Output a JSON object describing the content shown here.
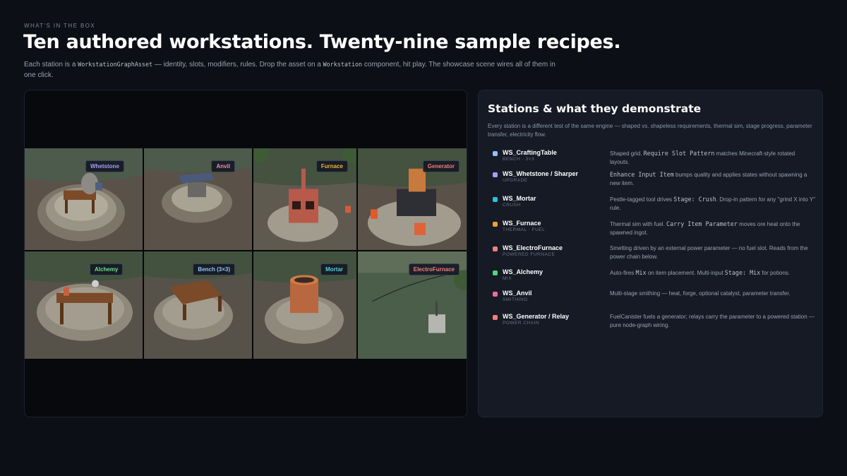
{
  "header": {
    "eyebrow": "WHAT'S IN THE BOX",
    "title": "Ten authored workstations. Twenty-nine sample recipes.",
    "lede": [
      {
        "t": "Each station is a "
      },
      {
        "t": "WorkstationGraphAsset",
        "code": true
      },
      {
        "t": " — identity, slots, modifiers, rules. Drop the asset on a "
      },
      {
        "t": "Workstation",
        "code": true
      },
      {
        "t": " component, hit play. The showcase scene wires all of them in one click."
      }
    ]
  },
  "showcase": {
    "tiles": [
      {
        "label": "Whetstone",
        "color": "#a99cff",
        "scene": "whetstone"
      },
      {
        "label": "Anvil",
        "color": "#f38ab5",
        "scene": "anvil"
      },
      {
        "label": "Furnace",
        "color": "#f0b440",
        "scene": "furnace"
      },
      {
        "label": "Generator",
        "color": "#f27d7d",
        "scene": "generator"
      },
      {
        "label": "Alchemy",
        "color": "#6ee08a",
        "scene": "alchemy"
      },
      {
        "label": "Bench (3×3)",
        "color": "#8fc2ff",
        "scene": "bench"
      },
      {
        "label": "Mortar",
        "color": "#4fd1e6",
        "scene": "mortar"
      },
      {
        "label": "ElectroFurnace",
        "color": "#f27d7d",
        "scene": "electro"
      }
    ]
  },
  "panel": {
    "title": "Stations & what they demonstrate",
    "subtitle": "Every station is a different test of the same engine — shaped vs. shapeless requirements, thermal sim, stage progress, parameter transfer, electricity flow.",
    "stations": [
      {
        "name": "WS_CraftingTable",
        "category": "BENCH · 3×3",
        "color": "#8fc2ff",
        "desc": [
          {
            "t": "Shaped grid. "
          },
          {
            "t": "Require Slot Pattern",
            "code": true
          },
          {
            "t": " matches Minecraft-style rotated layouts."
          }
        ]
      },
      {
        "name": "WS_Whetstone / Sharper",
        "category": "UPGRADE",
        "color": "#a99cff",
        "desc": [
          {
            "t": "Enhance Input Item",
            "code": true
          },
          {
            "t": " bumps quality and applies states without spawning a new item."
          }
        ]
      },
      {
        "name": "WS_Mortar",
        "category": "CRUSH",
        "color": "#2ec4dc",
        "desc": [
          {
            "t": "Pestle-tagged tool drives "
          },
          {
            "t": "Stage: Crush",
            "code": true
          },
          {
            "t": ". Drop-in pattern for any \"grind X into Y\" rule."
          }
        ]
      },
      {
        "name": "WS_Furnace",
        "category": "THERMAL · FUEL",
        "color": "#f0a030",
        "desc": [
          {
            "t": "Thermal sim with fuel. "
          },
          {
            "t": "Carry Item Parameter",
            "code": true
          },
          {
            "t": " moves ore heat onto the spawned ingot."
          }
        ]
      },
      {
        "name": "WS_ElectroFurnace",
        "category": "POWERED FURNACE",
        "color": "#f27d7d",
        "desc": [
          {
            "t": "Smelting driven by an external power parameter — no fuel slot. Reads from the power chain below."
          }
        ]
      },
      {
        "name": "WS_Alchemy",
        "category": "MIX",
        "color": "#4fd67a",
        "desc": [
          {
            "t": "Auto-fires "
          },
          {
            "t": "Mix",
            "code": true
          },
          {
            "t": " on item placement. Multi-input "
          },
          {
            "t": "Stage: Mix",
            "code": true
          },
          {
            "t": " for potions."
          }
        ]
      },
      {
        "name": "WS_Anvil",
        "category": "SMITHING",
        "color": "#f06a9a",
        "desc": [
          {
            "t": "Multi-stage smithing — heat, forge, optional catalyst, parameter transfer."
          }
        ]
      },
      {
        "name": "WS_Generator / Relay",
        "category": "POWER CHAIN",
        "color": "#f27d7d",
        "desc": [
          {
            "t": "FuelCanister fuels a generator; relays carry the parameter to a powered station — pure node-graph wiring."
          }
        ]
      }
    ]
  }
}
